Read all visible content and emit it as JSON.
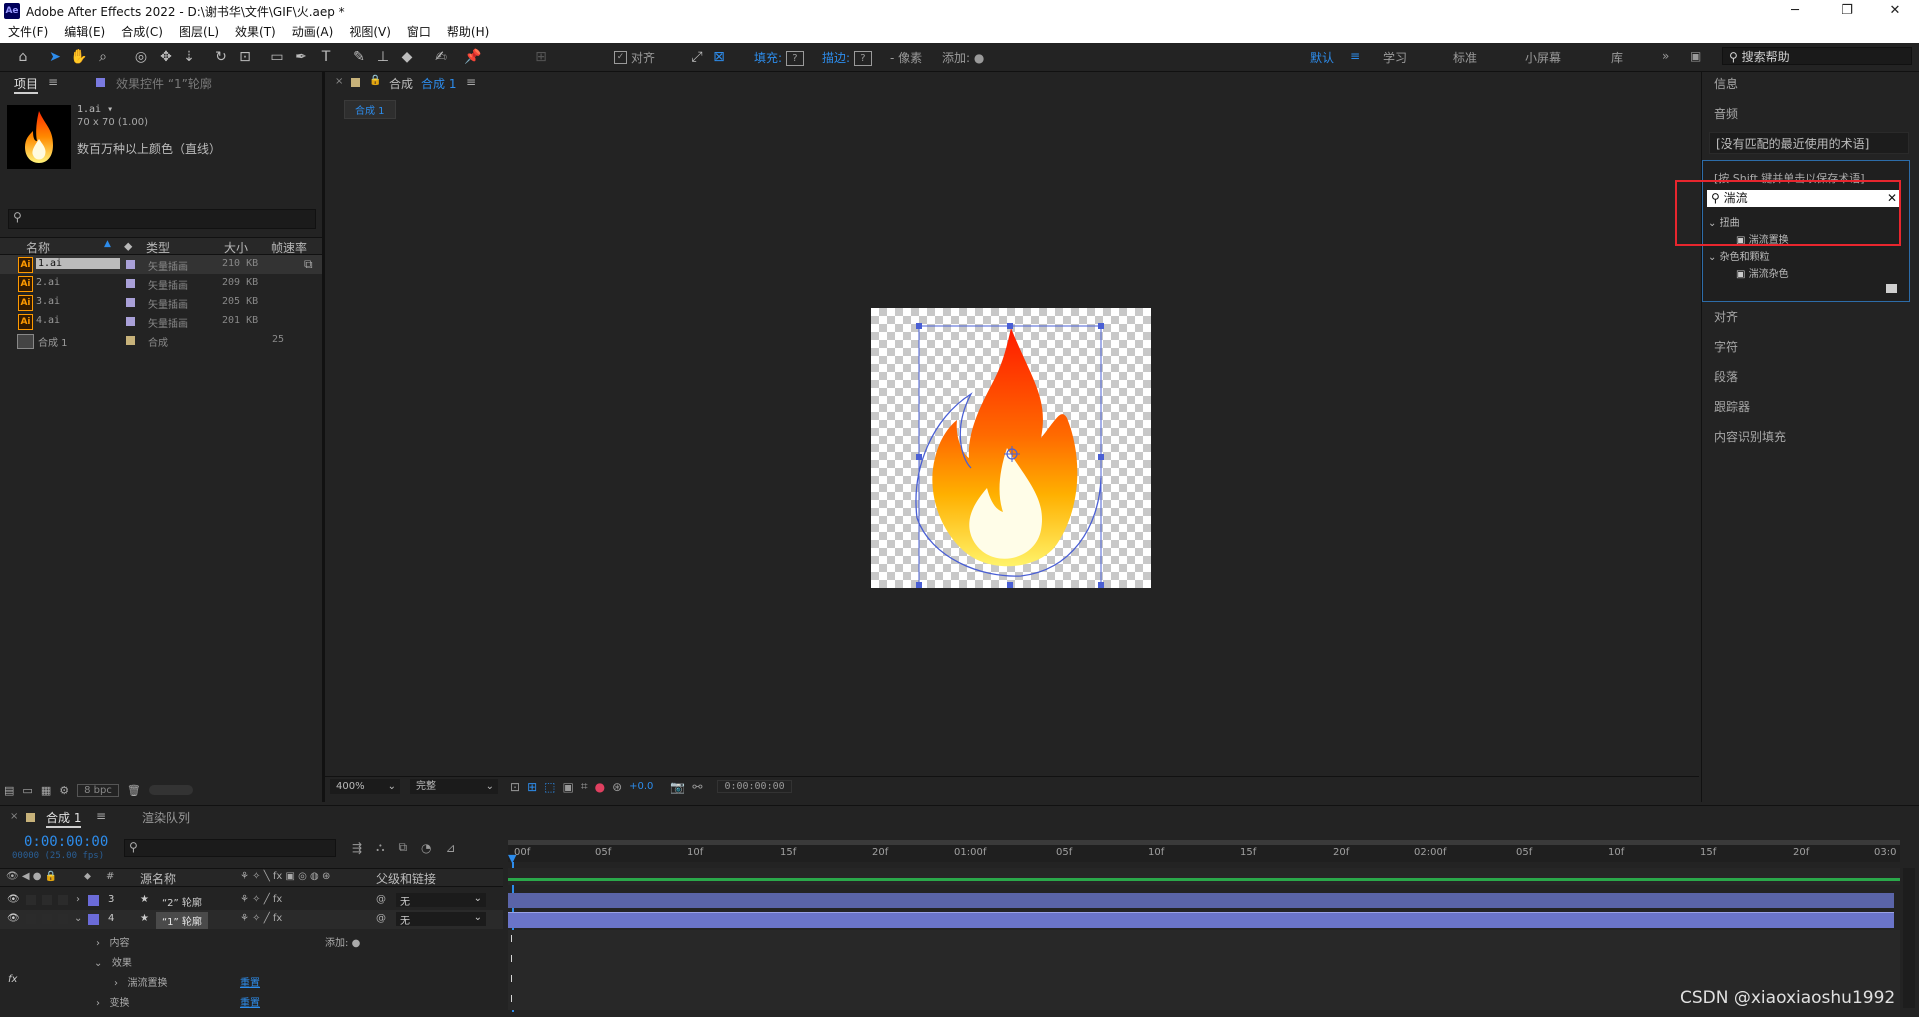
{
  "titlebar": {
    "app_icon": "Ae",
    "title": "Adobe After Effects 2022 - D:\\谢书华\\文件\\GIF\\火.aep *"
  },
  "menubar": [
    "文件(F)",
    "编辑(E)",
    "合成(C)",
    "图层(L)",
    "效果(T)",
    "动画(A)",
    "视图(V)",
    "窗口",
    "帮助(H)"
  ],
  "toolbar": {
    "align_label": "对齐",
    "fill_label": "填充:",
    "fill_box": "?",
    "stroke_label": "描边:",
    "stroke_box": "?",
    "stroke_units": "- 像素",
    "add_label": "添加:",
    "workspaces": [
      "默认",
      "学习",
      "标准",
      "小屏幕",
      "库"
    ],
    "help_search_placeholder": "搜索帮助"
  },
  "project": {
    "tab_project": "项目",
    "tab_effect_controls": "效果控件 “1”轮廓",
    "file_name": "1.ai ▾",
    "file_dims": "70 x 70 (1.00)",
    "file_colors": "数百万种以上颜色（直线）",
    "columns": [
      "名称",
      "类型",
      "大小",
      "帧速率"
    ],
    "items": [
      {
        "name": "1.ai",
        "type": "矢量插画",
        "size": "210 KB",
        "fps": ""
      },
      {
        "name": "2.ai",
        "type": "矢量插画",
        "size": "209 KB",
        "fps": ""
      },
      {
        "name": "3.ai",
        "type": "矢量插画",
        "size": "205 KB",
        "fps": ""
      },
      {
        "name": "4.ai",
        "type": "矢量插画",
        "size": "201 KB",
        "fps": ""
      },
      {
        "name": "合成 1",
        "type": "合成",
        "size": "",
        "fps": "25"
      }
    ],
    "bpc": "8 bpc"
  },
  "comp": {
    "tab_prefix": "合成",
    "tab_name": "合成 1",
    "subtab": "合成 1",
    "zoom": "400%",
    "quality": "完整",
    "exposure": "+0.0",
    "timecode": "0:00:00:00"
  },
  "right": {
    "info": "信息",
    "audio": "音频",
    "no_terms": "[没有匹配的最近使用的术语]",
    "shift_hint": "[按 Shift 键并单击以保存术语]",
    "fx_search_value": "湍流",
    "categories": [
      {
        "name": "扭曲",
        "effect": "湍流置换"
      },
      {
        "name": "杂色和颗粒",
        "effect": "湍流杂色"
      }
    ],
    "panels": [
      "对齐",
      "字符",
      "段落",
      "跟踪器",
      "内容识别填充"
    ]
  },
  "timeline": {
    "tab_comp": "合成 1",
    "tab_render": "渲染队列",
    "timecode": "0:00:00:00",
    "frames": "00000 (25.00 fps)",
    "col_source": "源名称",
    "col_parent": "父级和链接",
    "ruler": [
      "00f",
      "05f",
      "10f",
      "15f",
      "20f",
      "01:00f",
      "05f",
      "10f",
      "15f",
      "20f",
      "02:00f",
      "05f",
      "10f",
      "15f",
      "20f",
      "03:0"
    ],
    "layers": [
      {
        "num": "3",
        "name": "“2” 轮廓",
        "parent": "无"
      },
      {
        "num": "4",
        "name": "“1” 轮廓",
        "parent": "无"
      }
    ],
    "props": {
      "contents": "内容",
      "add": "添加:",
      "effects": "效果",
      "turb": "湍流置换",
      "reset1": "重置",
      "transform": "变换",
      "reset2": "重置"
    }
  },
  "watermark": "CSDN @xiaoxiaoshu1992"
}
